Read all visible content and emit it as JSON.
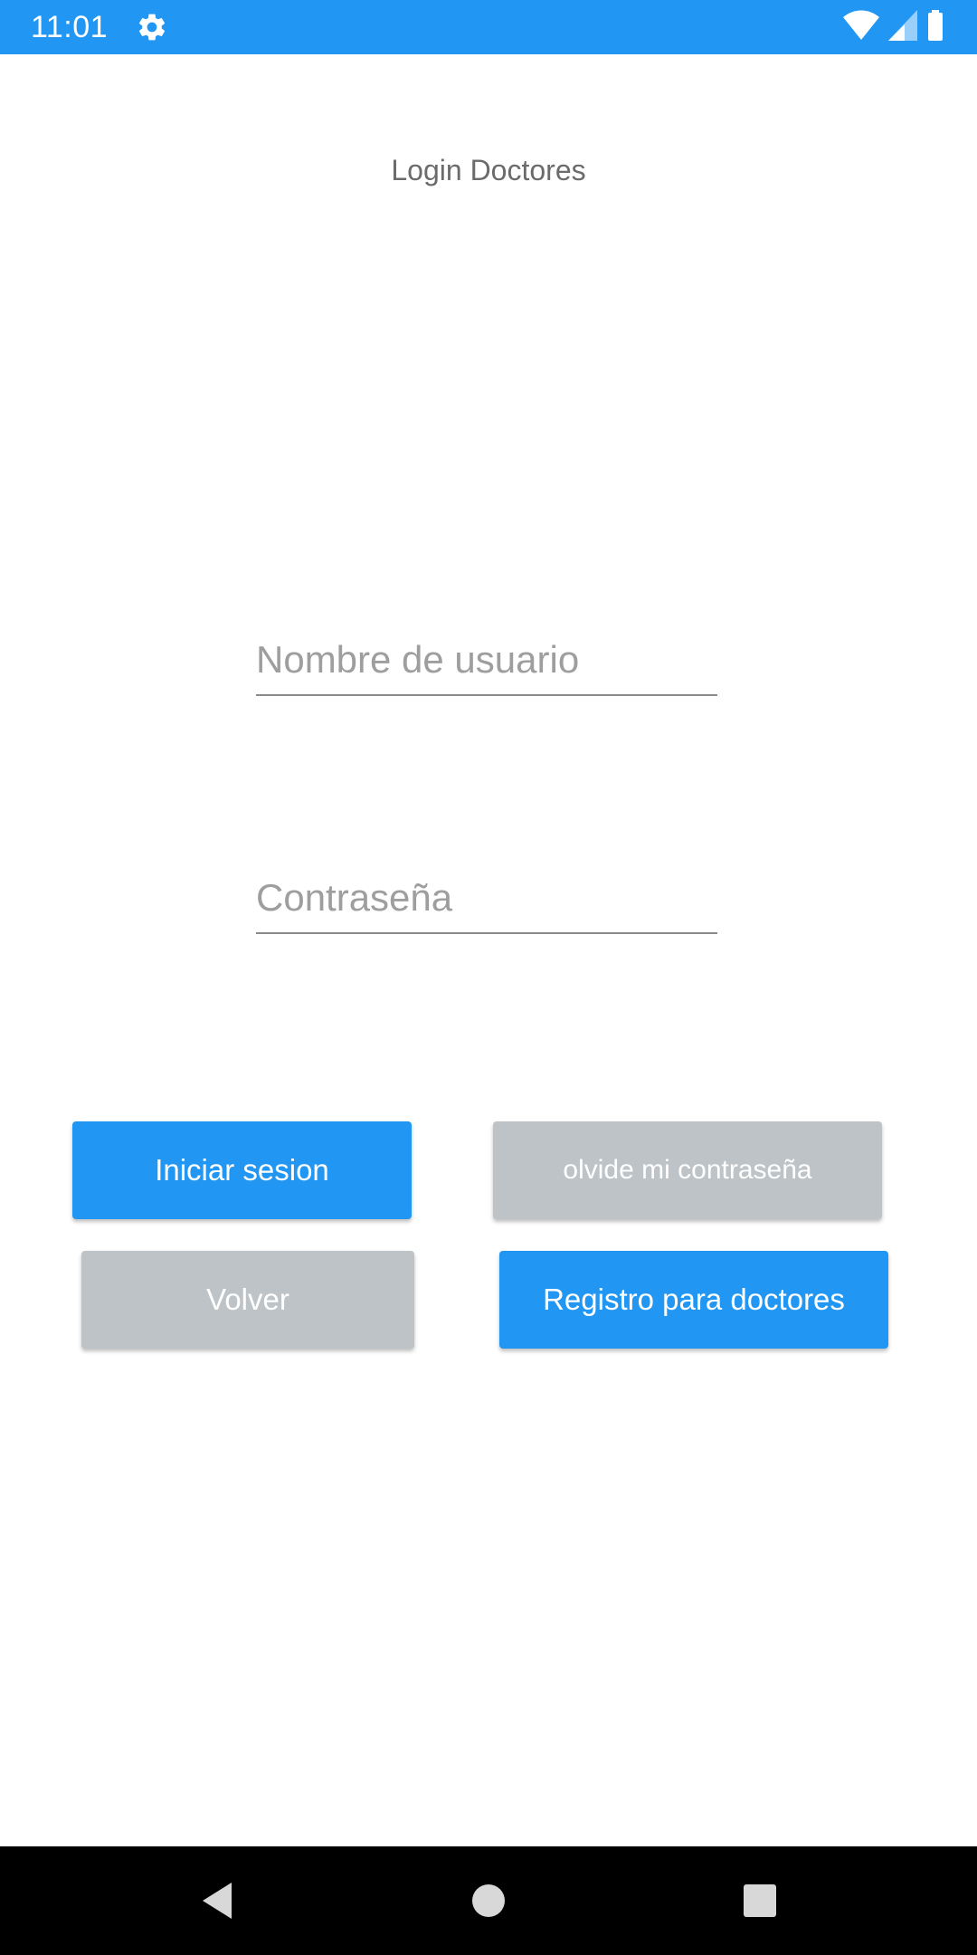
{
  "status_bar": {
    "time": "11:01",
    "color": "#2196F3",
    "icons": [
      "gear-icon",
      "wifi-icon",
      "signal-icon",
      "battery-icon"
    ]
  },
  "title": "Login Doctores",
  "form": {
    "username_placeholder": "Nombre de usuario",
    "password_placeholder": "Contraseña"
  },
  "buttons": {
    "login": "Iniciar sesion",
    "forgot_password": "olvide mi contraseña",
    "back": "Volver",
    "register": "Registro para doctores"
  },
  "colors": {
    "primary": "#2196F3",
    "secondary": "#BDC3C7"
  },
  "nav_bar": {
    "icons": [
      "back-icon",
      "home-icon",
      "recents-icon"
    ]
  }
}
